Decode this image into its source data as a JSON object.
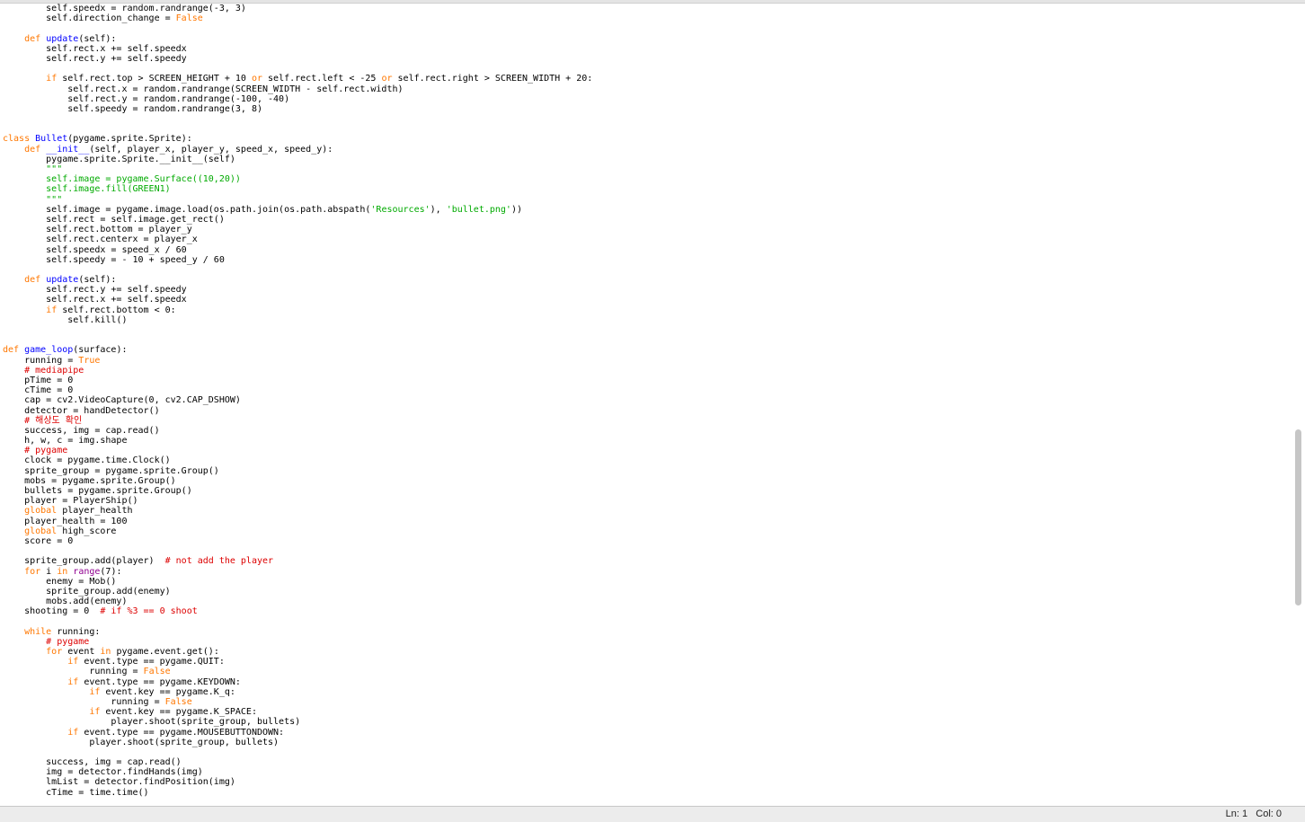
{
  "editor": {
    "lines": [
      [
        [
          "",
          "        self.speedx = random.randrange(-3, 3)"
        ]
      ],
      [
        [
          "",
          "        self.direction_change = "
        ],
        [
          "kw",
          "False"
        ]
      ],
      [
        [
          "",
          ""
        ]
      ],
      [
        [
          "",
          "    "
        ],
        [
          "kw",
          "def"
        ],
        [
          "",
          " "
        ],
        [
          "def",
          "update"
        ],
        [
          "",
          "(self):"
        ]
      ],
      [
        [
          "",
          "        self.rect.x += self.speedx"
        ]
      ],
      [
        [
          "",
          "        self.rect.y += self.speedy"
        ]
      ],
      [
        [
          "",
          ""
        ]
      ],
      [
        [
          "",
          "        "
        ],
        [
          "kw",
          "if"
        ],
        [
          "",
          " self.rect.top > SCREEN_HEIGHT + 10 "
        ],
        [
          "kw",
          "or"
        ],
        [
          "",
          " self.rect.left < -25 "
        ],
        [
          "kw",
          "or"
        ],
        [
          "",
          " self.rect.right > SCREEN_WIDTH + 20:"
        ]
      ],
      [
        [
          "",
          "            self.rect.x = random.randrange(SCREEN_WIDTH - self.rect.width)"
        ]
      ],
      [
        [
          "",
          "            self.rect.y = random.randrange(-100, -40)"
        ]
      ],
      [
        [
          "",
          "            self.speedy = random.randrange(3, 8)"
        ]
      ],
      [
        [
          "",
          ""
        ]
      ],
      [
        [
          "",
          ""
        ]
      ],
      [
        [
          "kw",
          "class"
        ],
        [
          "",
          " "
        ],
        [
          "def",
          "Bullet"
        ],
        [
          "",
          "(pygame.sprite.Sprite):"
        ]
      ],
      [
        [
          "",
          "    "
        ],
        [
          "kw",
          "def"
        ],
        [
          "",
          " "
        ],
        [
          "def",
          "__init__"
        ],
        [
          "",
          "(self, player_x, player_y, speed_x, speed_y):"
        ]
      ],
      [
        [
          "",
          "        pygame.sprite.Sprite.__init__(self)"
        ]
      ],
      [
        [
          "str",
          "        \"\"\""
        ]
      ],
      [
        [
          "str",
          "        self.image = pygame.Surface((10,20))"
        ]
      ],
      [
        [
          "str",
          "        self.image.fill(GREEN1)"
        ]
      ],
      [
        [
          "str",
          "        \"\"\""
        ]
      ],
      [
        [
          "",
          "        self.image = pygame.image.load(os.path.join(os.path.abspath("
        ],
        [
          "str",
          "'Resources'"
        ],
        [
          "",
          "), "
        ],
        [
          "str",
          "'bullet.png'"
        ],
        [
          "",
          "))"
        ]
      ],
      [
        [
          "",
          "        self.rect = self.image.get_rect()"
        ]
      ],
      [
        [
          "",
          "        self.rect.bottom = player_y"
        ]
      ],
      [
        [
          "",
          "        self.rect.centerx = player_x"
        ]
      ],
      [
        [
          "",
          "        self.speedx = speed_x / 60"
        ]
      ],
      [
        [
          "",
          "        self.speedy = - 10 + speed_y / 60"
        ]
      ],
      [
        [
          "",
          ""
        ]
      ],
      [
        [
          "",
          "    "
        ],
        [
          "kw",
          "def"
        ],
        [
          "",
          " "
        ],
        [
          "def",
          "update"
        ],
        [
          "",
          "(self):"
        ]
      ],
      [
        [
          "",
          "        self.rect.y += self.speedy"
        ]
      ],
      [
        [
          "",
          "        self.rect.x += self.speedx"
        ]
      ],
      [
        [
          "",
          "        "
        ],
        [
          "kw",
          "if"
        ],
        [
          "",
          " self.rect.bottom < 0:"
        ]
      ],
      [
        [
          "",
          "            self.kill()"
        ]
      ],
      [
        [
          "",
          ""
        ]
      ],
      [
        [
          "",
          ""
        ]
      ],
      [
        [
          "kw",
          "def"
        ],
        [
          "",
          " "
        ],
        [
          "def",
          "game_loop"
        ],
        [
          "",
          "(surface):"
        ]
      ],
      [
        [
          "",
          "    running = "
        ],
        [
          "kw",
          "True"
        ]
      ],
      [
        [
          "com",
          "    # mediapipe"
        ]
      ],
      [
        [
          "",
          "    pTime = 0"
        ]
      ],
      [
        [
          "",
          "    cTime = 0"
        ]
      ],
      [
        [
          "",
          "    cap = cv2.VideoCapture(0, cv2.CAP_DSHOW)"
        ]
      ],
      [
        [
          "",
          "    detector = handDetector()"
        ]
      ],
      [
        [
          "com",
          "    # 해상도 확인"
        ]
      ],
      [
        [
          "",
          "    success, img = cap.read()"
        ]
      ],
      [
        [
          "",
          "    h, w, c = img.shape"
        ]
      ],
      [
        [
          "com",
          "    # pygame"
        ]
      ],
      [
        [
          "",
          "    clock = pygame.time.Clock()"
        ]
      ],
      [
        [
          "",
          "    sprite_group = pygame.sprite.Group()"
        ]
      ],
      [
        [
          "",
          "    mobs = pygame.sprite.Group()"
        ]
      ],
      [
        [
          "",
          "    bullets = pygame.sprite.Group()"
        ]
      ],
      [
        [
          "",
          "    player = PlayerShip()"
        ]
      ],
      [
        [
          "kw",
          "    global"
        ],
        [
          "",
          " player_health"
        ]
      ],
      [
        [
          "",
          "    player_health = 100"
        ]
      ],
      [
        [
          "kw",
          "    global"
        ],
        [
          "",
          " high_score"
        ]
      ],
      [
        [
          "",
          "    score = 0"
        ]
      ],
      [
        [
          "",
          ""
        ]
      ],
      [
        [
          "",
          "    sprite_group.add(player)  "
        ],
        [
          "com",
          "# not add the player"
        ]
      ],
      [
        [
          "kw",
          "    for"
        ],
        [
          "",
          " i "
        ],
        [
          "kw",
          "in"
        ],
        [
          "",
          " "
        ],
        [
          "bi",
          "range"
        ],
        [
          "",
          "(7):"
        ]
      ],
      [
        [
          "",
          "        enemy = Mob()"
        ]
      ],
      [
        [
          "",
          "        sprite_group.add(enemy)"
        ]
      ],
      [
        [
          "",
          "        mobs.add(enemy)"
        ]
      ],
      [
        [
          "",
          "    shooting = 0  "
        ],
        [
          "com",
          "# if %3 == 0 shoot"
        ]
      ],
      [
        [
          "",
          ""
        ]
      ],
      [
        [
          "kw",
          "    while"
        ],
        [
          "",
          " running:"
        ]
      ],
      [
        [
          "com",
          "        # pygame"
        ]
      ],
      [
        [
          "kw",
          "        for"
        ],
        [
          "",
          " event "
        ],
        [
          "kw",
          "in"
        ],
        [
          "",
          " pygame.event.get():"
        ]
      ],
      [
        [
          "kw",
          "            if"
        ],
        [
          "",
          " event.type == pygame.QUIT:"
        ]
      ],
      [
        [
          "",
          "                running = "
        ],
        [
          "kw",
          "False"
        ]
      ],
      [
        [
          "kw",
          "            if"
        ],
        [
          "",
          " event.type == pygame.KEYDOWN:"
        ]
      ],
      [
        [
          "kw",
          "                if"
        ],
        [
          "",
          " event.key == pygame.K_q:"
        ]
      ],
      [
        [
          "",
          "                    running = "
        ],
        [
          "kw",
          "False"
        ]
      ],
      [
        [
          "kw",
          "                if"
        ],
        [
          "",
          " event.key == pygame.K_SPACE:"
        ]
      ],
      [
        [
          "",
          "                    player.shoot(sprite_group, bullets)"
        ]
      ],
      [
        [
          "kw",
          "            if"
        ],
        [
          "",
          " event.type == pygame.MOUSEBUTTONDOWN:"
        ]
      ],
      [
        [
          "",
          "                player.shoot(sprite_group, bullets)"
        ]
      ],
      [
        [
          "",
          ""
        ]
      ],
      [
        [
          "",
          "        success, img = cap.read()"
        ]
      ],
      [
        [
          "",
          "        img = detector.findHands(img)"
        ]
      ],
      [
        [
          "",
          "        lmList = detector.findPosition(img)"
        ]
      ],
      [
        [
          "",
          "        cTime = time.time()"
        ]
      ]
    ],
    "scroll_position": 0.68
  },
  "status_bar": {
    "cursor": "Ln: 1   Col: 0"
  }
}
